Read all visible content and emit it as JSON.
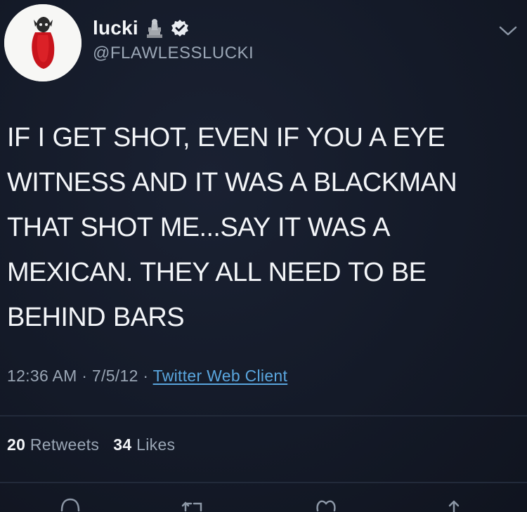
{
  "user": {
    "display_name": "lucki",
    "handle": "@FLAWLESSLUCKI",
    "verified": true,
    "emoji_icon": "statue-emoji"
  },
  "tweet": {
    "lines": [
      "IF I GET SHOT, EVEN IF YOU A EYE",
      "WITNESS AND IT WAS A BLACKMAN",
      "THAT SHOT ME...SAY IT WAS A",
      "MEXICAN. THEY ALL  NEED TO BE",
      "BEHIND BARS"
    ],
    "time": "12:36 AM",
    "date": "7/5/12",
    "separator": " · ",
    "source": "Twitter Web Client"
  },
  "stats": {
    "retweets_count": "20",
    "retweets_label": "Retweets",
    "likes_count": "34",
    "likes_label": "Likes"
  },
  "colors": {
    "background": "#131826",
    "text": "#f3f5f8",
    "secondary": "#9aa6b5",
    "link": "#5aa6de"
  },
  "icons": {
    "menu": "chevron-down-icon",
    "reply": "reply-icon",
    "retweet": "retweet-icon",
    "like": "heart-icon",
    "share": "share-icon"
  }
}
